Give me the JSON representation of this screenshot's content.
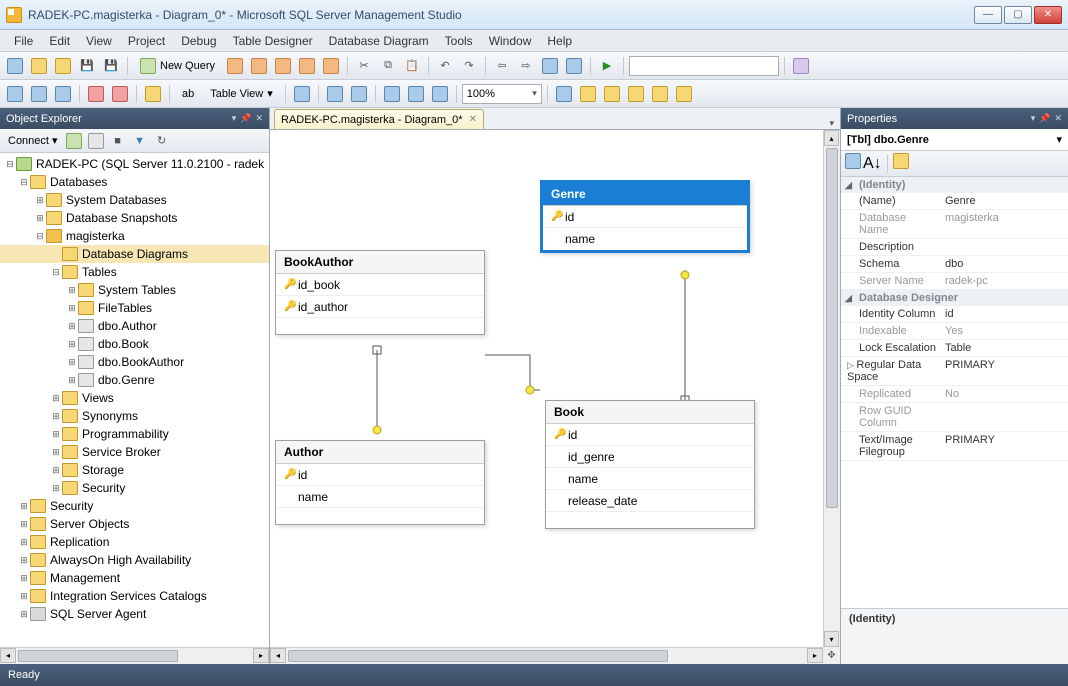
{
  "window": {
    "title": "RADEK-PC.magisterka - Diagram_0* - Microsoft SQL Server Management Studio"
  },
  "menu": [
    "File",
    "Edit",
    "View",
    "Project",
    "Debug",
    "Table Designer",
    "Database Diagram",
    "Tools",
    "Window",
    "Help"
  ],
  "toolbar1": {
    "new_query": "New Query"
  },
  "toolbar2": {
    "table_view": "Table View",
    "zoom": "100%",
    "ab": "ab"
  },
  "object_explorer": {
    "title": "Object Explorer",
    "connect": "Connect",
    "root": "RADEK-PC (SQL Server 11.0.2100 - radek",
    "databases": "Databases",
    "sysdb": "System Databases",
    "snapshots": "Database Snapshots",
    "dbname": "magisterka",
    "diagrams": "Database Diagrams",
    "tables": "Tables",
    "systables": "System Tables",
    "filetables": "FileTables",
    "t_author": "dbo.Author",
    "t_book": "dbo.Book",
    "t_bookauthor": "dbo.BookAuthor",
    "t_genre": "dbo.Genre",
    "views": "Views",
    "synonyms": "Synonyms",
    "programmability": "Programmability",
    "servicebroker": "Service Broker",
    "storage": "Storage",
    "security1": "Security",
    "security2": "Security",
    "serverobjects": "Server Objects",
    "replication": "Replication",
    "alwayson": "AlwaysOn High Availability",
    "management": "Management",
    "isc": "Integration Services Catalogs",
    "agent": "SQL Server Agent"
  },
  "tab": {
    "label": "RADEK-PC.magisterka - Diagram_0*"
  },
  "diagram": {
    "genre": {
      "name": "Genre",
      "cols": [
        "id",
        "name"
      ]
    },
    "bookauthor": {
      "name": "BookAuthor",
      "cols": [
        "id_book",
        "id_author"
      ]
    },
    "author": {
      "name": "Author",
      "cols": [
        "id",
        "name"
      ]
    },
    "book": {
      "name": "Book",
      "cols": [
        "id",
        "id_genre",
        "name",
        "release_date"
      ]
    }
  },
  "properties": {
    "title": "Properties",
    "selector": "[Tbl] dbo.Genre",
    "cat_identity": "(Identity)",
    "name_k": "(Name)",
    "name_v": "Genre",
    "dbname_k": "Database Name",
    "dbname_v": "magisterka",
    "desc_k": "Description",
    "desc_v": "",
    "schema_k": "Schema",
    "schema_v": "dbo",
    "server_k": "Server Name",
    "server_v": "radek-pc",
    "cat_dd": "Database Designer",
    "idcol_k": "Identity Column",
    "idcol_v": "id",
    "index_k": "Indexable",
    "index_v": "Yes",
    "lock_k": "Lock Escalation",
    "lock_v": "Table",
    "reg_k": "Regular Data Space",
    "reg_v": "PRIMARY",
    "repl_k": "Replicated",
    "repl_v": "No",
    "rowguid_k": "Row GUID Column",
    "rowguid_v": "",
    "txtimg_k": "Text/Image Filegroup",
    "txtimg_v": "PRIMARY",
    "help_title": "(Identity)"
  },
  "status": {
    "ready": "Ready"
  }
}
